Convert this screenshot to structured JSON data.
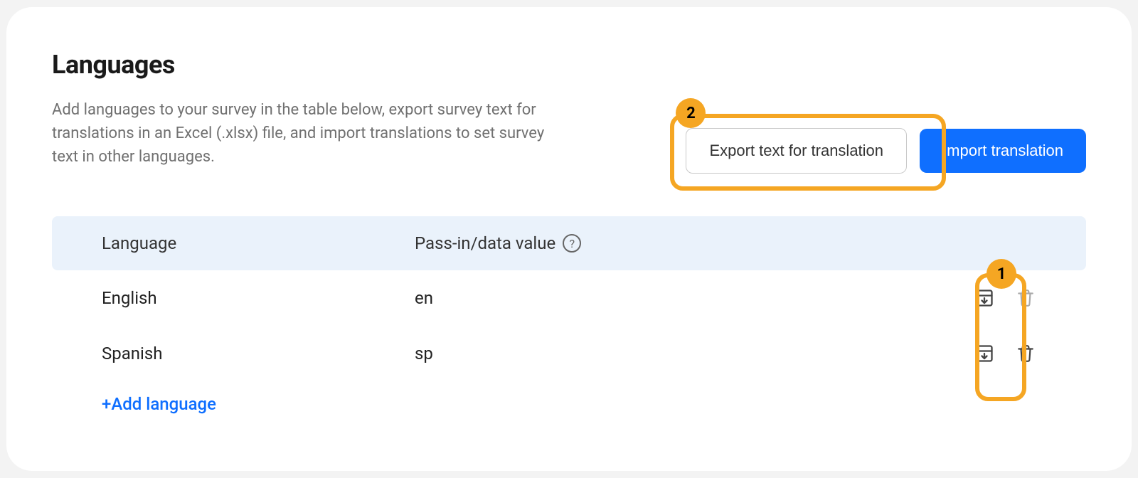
{
  "header": {
    "title": "Languages",
    "description": "Add languages to your survey in the table below, export survey text for translations in an Excel (.xlsx) file, and import translations to set survey text in other languages."
  },
  "actions": {
    "export_label": "Export text for translation",
    "import_label": "Import translation"
  },
  "table": {
    "columns": {
      "language": "Language",
      "value": "Pass-in/data value"
    },
    "rows": [
      {
        "language": "English",
        "value": "en",
        "deletable": false
      },
      {
        "language": "Spanish",
        "value": "sp",
        "deletable": true
      }
    ],
    "add_label": "+Add language"
  },
  "annotations": {
    "badge1": "1",
    "badge2": "2"
  }
}
